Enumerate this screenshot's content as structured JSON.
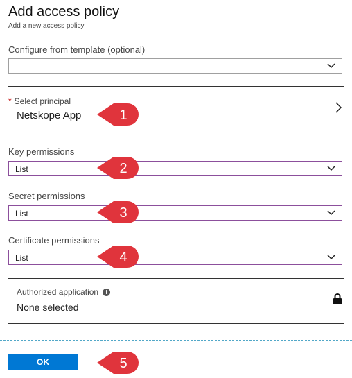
{
  "header": {
    "title": "Add access policy",
    "subtitle": "Add a new access policy"
  },
  "template": {
    "label": "Configure from template (optional)",
    "value": ""
  },
  "principal": {
    "required_marker": "*",
    "label": "Select principal",
    "value": "Netskope App"
  },
  "key_permissions": {
    "label": "Key permissions",
    "value": "List"
  },
  "secret_permissions": {
    "label": "Secret permissions",
    "value": "List"
  },
  "certificate_permissions": {
    "label": "Certificate permissions",
    "value": "List"
  },
  "authorized_application": {
    "label": "Authorized application",
    "info_glyph": "i",
    "value": "None selected"
  },
  "ok_button": {
    "label": "OK"
  },
  "callouts": [
    "1",
    "2",
    "3",
    "4",
    "5"
  ],
  "colors": {
    "callout": "#e0343c",
    "accent": "#0078d4",
    "select_border": "#8c4f9c"
  },
  "icons": [
    "chevron-down-icon",
    "chevron-right-icon",
    "info-icon",
    "lock-icon"
  ]
}
